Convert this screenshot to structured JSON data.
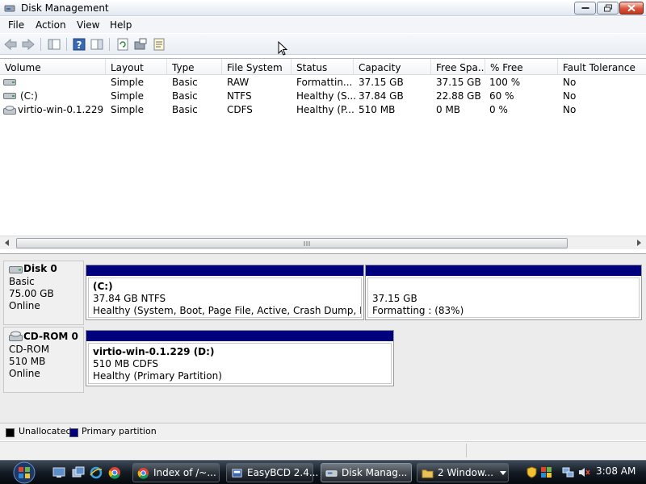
{
  "window": {
    "title": "Disk Management"
  },
  "menu": [
    "File",
    "Action",
    "View",
    "Help"
  ],
  "toolbar": {
    "icons": [
      "back-icon",
      "forward-icon",
      "console-tree-icon",
      "help-icon",
      "properties-view-icon",
      "refresh-icon",
      "rescan-disks-icon",
      "export-list-icon"
    ]
  },
  "volume_list": {
    "columns": [
      "Volume",
      "Layout",
      "Type",
      "File System",
      "Status",
      "Capacity",
      "Free Spa...",
      "% Free",
      "Fault Tolerance"
    ],
    "rows": [
      [
        "",
        "Simple",
        "Basic",
        "RAW",
        "Formattin...",
        "37.15 GB",
        "37.15 GB",
        "100 %",
        "No"
      ],
      [
        "(C:)",
        "Simple",
        "Basic",
        "NTFS",
        "Healthy (S...",
        "37.84 GB",
        "22.88 GB",
        "60 %",
        "No"
      ],
      [
        "virtio-win-0.1.229 ...",
        "Simple",
        "Basic",
        "CDFS",
        "Healthy (P...",
        "510 MB",
        "0 MB",
        "0 %",
        "No"
      ]
    ]
  },
  "disks": [
    {
      "name": "Disk 0",
      "type": "Basic",
      "size": "75.00 GB",
      "state": "Online",
      "partitions": [
        {
          "title": "(C:)",
          "detail": "37.84 GB NTFS",
          "status": "Healthy (System, Boot, Page File, Active, Crash Dump, Primary"
        },
        {
          "title": "",
          "detail": "37.15 GB",
          "status": "Formatting : (83%)"
        }
      ]
    },
    {
      "name": "CD-ROM 0",
      "type": "CD-ROM",
      "size": "510 MB",
      "state": "Online",
      "partitions": [
        {
          "title": "virtio-win-0.1.229  (D:)",
          "detail": "510 MB CDFS",
          "status": "Healthy (Primary Partition)"
        }
      ]
    }
  ],
  "legend": [
    {
      "label": "Unallocated",
      "color": "#000000"
    },
    {
      "label": "Primary partition",
      "color": "#00007f"
    }
  ],
  "taskbar": {
    "tasks": [
      {
        "label": "Index of /~...",
        "icon": "chrome-icon"
      },
      {
        "label": "EasyBCD 2.4...",
        "icon": "easybcd-icon"
      },
      {
        "label": "Disk Manag...",
        "icon": "disk-management-icon"
      },
      {
        "label": "2  Window...",
        "icon": "folder-icon"
      }
    ],
    "clock": "3:08 AM"
  },
  "colors": {
    "primary_partition": "#00007f",
    "taskbar": "#141b24"
  }
}
